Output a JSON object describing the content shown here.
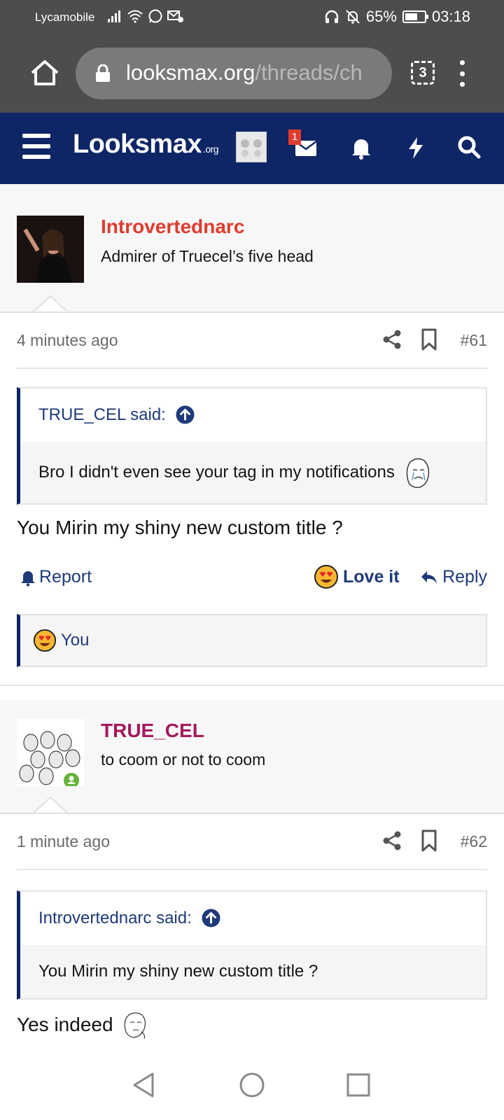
{
  "status": {
    "carrier": "Lycamobile",
    "battery": "65%",
    "battery_level": 0.65,
    "time": "03:18"
  },
  "browser": {
    "url_host": "looksmax.org",
    "url_path": "/threads/ch",
    "tab_count": "3"
  },
  "header": {
    "logo_main": "Looksmax",
    "logo_suffix": ".org",
    "mail_badge": "1"
  },
  "posts": [
    {
      "username": "Introvertednarc",
      "username_color": "#e03b2e",
      "user_title": "Admirer of Truecel’s five head",
      "time": "4 minutes ago",
      "number": "#61",
      "quote_author": "TRUE_CEL said:",
      "quote_text": "Bro I didn't even see your tag in my notifications",
      "message": "You Mirin my shiny new custom title ?",
      "actions": {
        "report": "Report",
        "love": "Love it",
        "reply": "Reply"
      },
      "reaction_by": "You"
    },
    {
      "username": "TRUE_CEL",
      "username_color": "#a31a5d",
      "user_title": "to coom or not to coom",
      "time": "1 minute ago",
      "number": "#62",
      "quote_author": "Introvertednarc said:",
      "quote_text": "You Mirin my shiny new custom title ?",
      "message": "Yes indeed"
    }
  ],
  "colors": {
    "header_bg": "#0e2566",
    "link": "#1e3a7a",
    "status_bg": "#4d4d4d"
  }
}
